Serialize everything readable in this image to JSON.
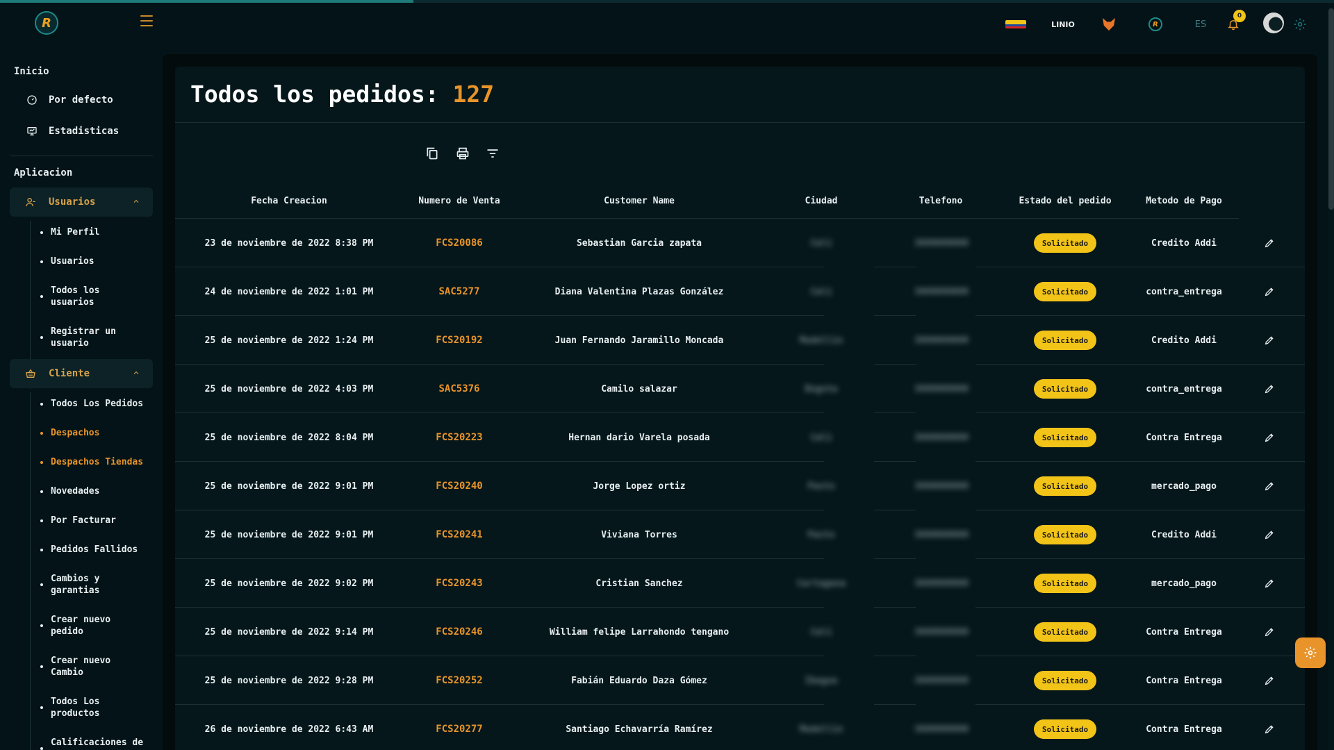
{
  "progress": {
    "value": 0.31,
    "color": "#1f7a7a"
  },
  "topbar": {
    "lang": "ES",
    "notifications": "0",
    "linio_label": "LINIO"
  },
  "sidebar": {
    "sections": [
      {
        "title": "Inicio"
      },
      {
        "title": "Aplicacion"
      }
    ],
    "inicio_items": [
      {
        "label": "Por defecto",
        "icon": "dashboard-icon"
      },
      {
        "label": "Estadisticas",
        "icon": "chart-icon"
      }
    ],
    "groups": [
      {
        "label": "Usuarios",
        "icon": "user-icon"
      },
      {
        "label": "Cliente",
        "icon": "basket-icon"
      }
    ],
    "usuarios_items": [
      {
        "label": "Mi Perfil"
      },
      {
        "label": "Usuarios"
      },
      {
        "label": "Todos los usuarios"
      },
      {
        "label": "Registrar un usuario"
      }
    ],
    "cliente_items": [
      {
        "label": "Todos Los Pedidos"
      },
      {
        "label": "Despachos"
      },
      {
        "label": "Despachos Tiendas"
      },
      {
        "label": "Novedades"
      },
      {
        "label": "Por Facturar"
      },
      {
        "label": "Pedidos Fallidos"
      },
      {
        "label": "Cambios y garantias"
      },
      {
        "label": "Crear nuevo pedido"
      },
      {
        "label": "Crear nuevo Cambio"
      },
      {
        "label": "Todos Los productos"
      },
      {
        "label": "Calificaciones de"
      }
    ]
  },
  "page": {
    "title": "Todos los pedidos:",
    "count": "127"
  },
  "toolbar": {
    "icons": [
      "copy-icon",
      "print-icon",
      "filter-icon"
    ]
  },
  "table": {
    "headers": [
      "Fecha Creacion",
      "Numero de Venta",
      "Customer Name",
      "Ciudad",
      "Telefono",
      "Estado del pedido",
      "Metodo de Pago"
    ],
    "rows": [
      {
        "fecha": "23 de noviembre de 2022 8:38 PM",
        "venta": "FCS20086",
        "name": "Sebastian Garcia zapata",
        "ciudad": "Cali",
        "tel": "3000000000",
        "estado": "Solicitado",
        "pago": "Credito Addi"
      },
      {
        "fecha": "24 de noviembre de 2022 1:01 PM",
        "venta": "SAC5277",
        "name": "Diana Valentina Plazas González",
        "ciudad": "Cali",
        "tel": "3000000000",
        "estado": "Solicitado",
        "pago": "contra_entrega"
      },
      {
        "fecha": "25 de noviembre de 2022 1:24 PM",
        "venta": "FCS20192",
        "name": "Juan Fernando Jaramillo Moncada",
        "ciudad": "Medellin",
        "tel": "3000000000",
        "estado": "Solicitado",
        "pago": "Credito Addi"
      },
      {
        "fecha": "25 de noviembre de 2022 4:03 PM",
        "venta": "SAC5376",
        "name": "Camilo salazar",
        "ciudad": "Bogota",
        "tel": "3000000000",
        "estado": "Solicitado",
        "pago": "contra_entrega"
      },
      {
        "fecha": "25 de noviembre de 2022 8:04 PM",
        "venta": "FCS20223",
        "name": "Hernan dario Varela posada",
        "ciudad": "Cali",
        "tel": "3000000000",
        "estado": "Solicitado",
        "pago": "Contra Entrega"
      },
      {
        "fecha": "25 de noviembre de 2022 9:01 PM",
        "venta": "FCS20240",
        "name": "Jorge Lopez ortiz",
        "ciudad": "Pasto",
        "tel": "3000000000",
        "estado": "Solicitado",
        "pago": "mercado_pago"
      },
      {
        "fecha": "25 de noviembre de 2022 9:01 PM",
        "venta": "FCS20241",
        "name": "Viviana Torres",
        "ciudad": "Pasto",
        "tel": "3000000000",
        "estado": "Solicitado",
        "pago": "Credito Addi"
      },
      {
        "fecha": "25 de noviembre de 2022 9:02 PM",
        "venta": "FCS20243",
        "name": "Cristian Sanchez",
        "ciudad": "Cartagena",
        "tel": "3000000000",
        "estado": "Solicitado",
        "pago": "mercado_pago"
      },
      {
        "fecha": "25 de noviembre de 2022 9:14 PM",
        "venta": "FCS20246",
        "name": "William felipe Larrahondo tengano",
        "ciudad": "Cali",
        "tel": "3000000000",
        "estado": "Solicitado",
        "pago": "Contra Entrega"
      },
      {
        "fecha": "25 de noviembre de 2022 9:28 PM",
        "venta": "FCS20252",
        "name": "Fabián Eduardo Daza Gómez",
        "ciudad": "Ibague",
        "tel": "3000000000",
        "estado": "Solicitado",
        "pago": "Contra Entrega"
      },
      {
        "fecha": "26 de noviembre de 2022 6:43 AM",
        "venta": "FCS20277",
        "name": "Santiago Echavarría Ramírez",
        "ciudad": "Medellin",
        "tel": "3000000000",
        "estado": "Solicitado",
        "pago": "Contra Entrega"
      }
    ]
  }
}
